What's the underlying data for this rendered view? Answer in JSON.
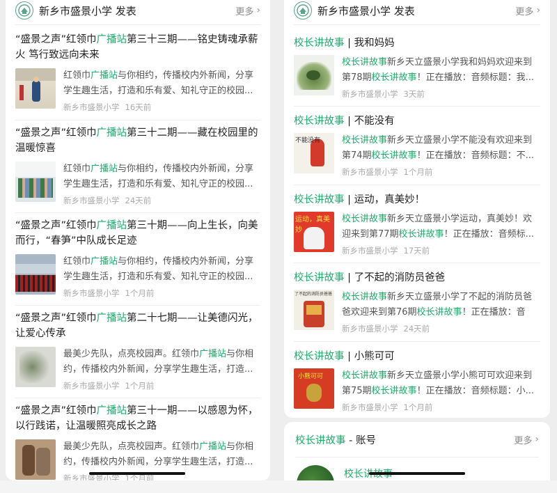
{
  "left": {
    "account": "新乡市盛景小学 发表",
    "more": "更多",
    "articles": [
      {
        "title_pre": "“盛景之声”红领巾",
        "title_hl": "广播站",
        "title_post": "第三十三期——铭史铸魂承薪火 笃行致远向未来",
        "desc_pre": "红领巾",
        "desc_hl": "广播站",
        "desc_post": "与你相约，传播校内外新闻，分享学生趣生活，打造和乐有爱、知礼守正的校园...",
        "source": "新乡市盛景小学",
        "time": "16天前"
      },
      {
        "title_pre": "“盛景之声”红领巾",
        "title_hl": "广播站",
        "title_post": "第三十二期——藏在校园里的温暖惊喜",
        "desc_pre": "红领巾",
        "desc_hl": "广播站",
        "desc_post": "与你相约，传播校内外新闻，分享学生趣生活，打造和乐有爱、知礼守正的校园...",
        "source": "新乡市盛景小学",
        "time": "24天前"
      },
      {
        "title_pre": "“盛景之声”红领巾",
        "title_hl": "广播站",
        "title_post": "第三十期——向上生长，向美而行，“春笋”中队成长足迹",
        "desc_pre": "红领巾",
        "desc_hl": "广播站",
        "desc_post": "与你相约，传播校内外新闻，分享学生趣生活，打造和乐有爱、知礼守正的校园...",
        "source": "新乡市盛景小学",
        "time": "1个月前"
      },
      {
        "title_pre": "“盛景之声”红领巾",
        "title_hl": "广播站",
        "title_post": "第二十七期——让美德闪光，让爱心传承",
        "desc_pre": "最美少先队，点亮校园声。红领巾",
        "desc_hl": "广播站",
        "desc_post": "与你相约，传播校内外新闻，分享学生趣生活，打造...",
        "source": "新乡市盛景小学",
        "time": "1个月前"
      },
      {
        "title_pre": "“盛景之声”红领巾",
        "title_hl": "广播站",
        "title_post": "第三十一期——以感恩为怀，以行践诺，让温暖照亮成长之路",
        "desc_pre": "最美少先队，点亮校园声。红领巾",
        "desc_hl": "广播站",
        "desc_post": "与你相约，传播校内外新闻，分享学生趣生活，打造...",
        "source": "新乡市盛景小学",
        "time": "1个月前"
      }
    ]
  },
  "right": {
    "account": "新乡市盛景小学 发表",
    "more": "更多",
    "stories": [
      {
        "tag": "校长讲故事",
        "title": " | 我和妈妈",
        "desc_hl": "校长讲故事",
        "desc_mid": "新乡天立盛景小学我和妈妈欢迎来到第78期",
        "desc_hl2": "校长讲故事",
        "desc_post": "！正在播放：音频标题：我...",
        "source": "新乡市盛景小学",
        "time": "3天前"
      },
      {
        "tag": "校长讲故事",
        "title": " | 不能没有",
        "desc_hl": "校长讲故事",
        "desc_mid": "新乡天立盛景小学不能没有欢迎来到第74期",
        "desc_hl2": "校长讲故事",
        "desc_post": "！正在播放：音频标题：不...",
        "source": "新乡市盛景小学",
        "time": "1个月前"
      },
      {
        "tag": "校长讲故事",
        "title": " | 运动，真美妙！",
        "desc_hl": "校长讲故事",
        "desc_mid": "新乡天立盛景小学运动，真美妙！欢迎来到第77期",
        "desc_hl2": "校长讲故事",
        "desc_post": "！正在播放：音频标...",
        "source": "新乡市盛景小学",
        "time": "17天前"
      },
      {
        "tag": "校长讲故事",
        "title": " | 了不起的消防员爸爸",
        "desc_hl": "校长讲故事",
        "desc_mid": "新乡天立盛景小学了不起的消防员爸爸欢迎来到第76期",
        "desc_hl2": "校长讲故事",
        "desc_post": "！正在播放：音频...",
        "source": "新乡市盛景小学",
        "time": "24天前"
      },
      {
        "tag": "校长讲故事",
        "title": " | 小熊可可",
        "desc_hl": "校长讲故事",
        "desc_mid": "新乡天立盛景小学小熊可可欢迎来到第75期",
        "desc_hl2": "校长讲故事",
        "desc_post": "！正在播放：音频标题：小...",
        "source": "新乡市盛景小学",
        "time": "1个月前"
      }
    ],
    "covers": [
      "",
      "不能没有",
      "运动，真美妙",
      "了不起的消防员爸爸",
      "小熊可可"
    ]
  },
  "account_section": {
    "title_hl": "校长讲故事",
    "title_post": " - 账号",
    "more": "更多",
    "name": "校长讲故事"
  },
  "colors": {
    "accent": "#1aad6a",
    "meta": "#aaaaaa",
    "bg": "#eeeeee"
  }
}
